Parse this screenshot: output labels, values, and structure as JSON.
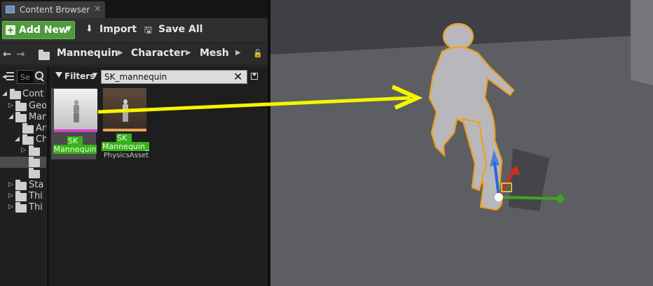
{
  "window": {
    "tab_title": "Content Browser",
    "tab_close": "×"
  },
  "toolbar": {
    "add_new_label": "Add New",
    "import_label": "Import",
    "save_all_label": "Save All"
  },
  "breadcrumb": {
    "items": [
      "Mannequin",
      "Character",
      "Mesh"
    ]
  },
  "tree": {
    "search_placeholder": "Se",
    "items": [
      "Cont",
      "Geo",
      "Man",
      "An",
      "Ch",
      "",
      "",
      "Sta",
      "Thi",
      "Thi"
    ]
  },
  "asset_view": {
    "filters_label": "Filters",
    "search_value": "SK_mannequin",
    "assets": [
      {
        "name_line1": "SK_",
        "name_line2": "Mannequin",
        "subtitle": ""
      },
      {
        "name_line1": "SK_",
        "name_line2": "Mannequin_",
        "subtitle": "PhysicsAsset"
      }
    ]
  },
  "colors": {
    "add_new": "#4e9a3c",
    "search_highlight": "#38b21b",
    "skeletal_mesh_bar": "#d23fd0",
    "physics_asset_bar": "#e8a35a",
    "selection_outline": "#f0a020",
    "annotation_arrow": "#f5f500"
  },
  "icons": [
    "content-browser-icon",
    "plus-icon",
    "import-icon",
    "save-icon",
    "back-icon",
    "forward-icon",
    "folder-icon",
    "lock-icon",
    "search-icon",
    "filter-icon",
    "clear-icon"
  ]
}
